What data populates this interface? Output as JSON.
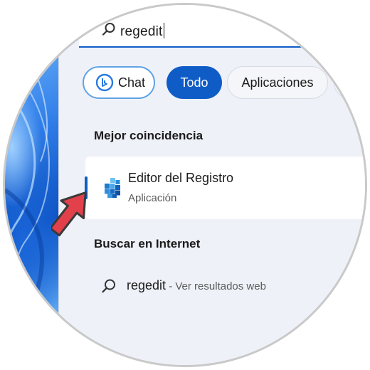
{
  "search": {
    "query": "regedit"
  },
  "filters": {
    "chat_label": "Chat",
    "all_label": "Todo",
    "apps_label": "Aplicaciones"
  },
  "best_match": {
    "section_title": "Mejor coincidencia",
    "name": "Editor del Registro",
    "type": "Aplicación",
    "icon": "regedit-icon"
  },
  "internet": {
    "section_title": "Buscar en Internet",
    "query": "regedit",
    "suffix": " - Ver resultados web",
    "icon": "search-icon"
  },
  "colors": {
    "accent": "#0f5cc6",
    "panel_bg": "#eef1f8",
    "pointer": "#e2404a"
  }
}
